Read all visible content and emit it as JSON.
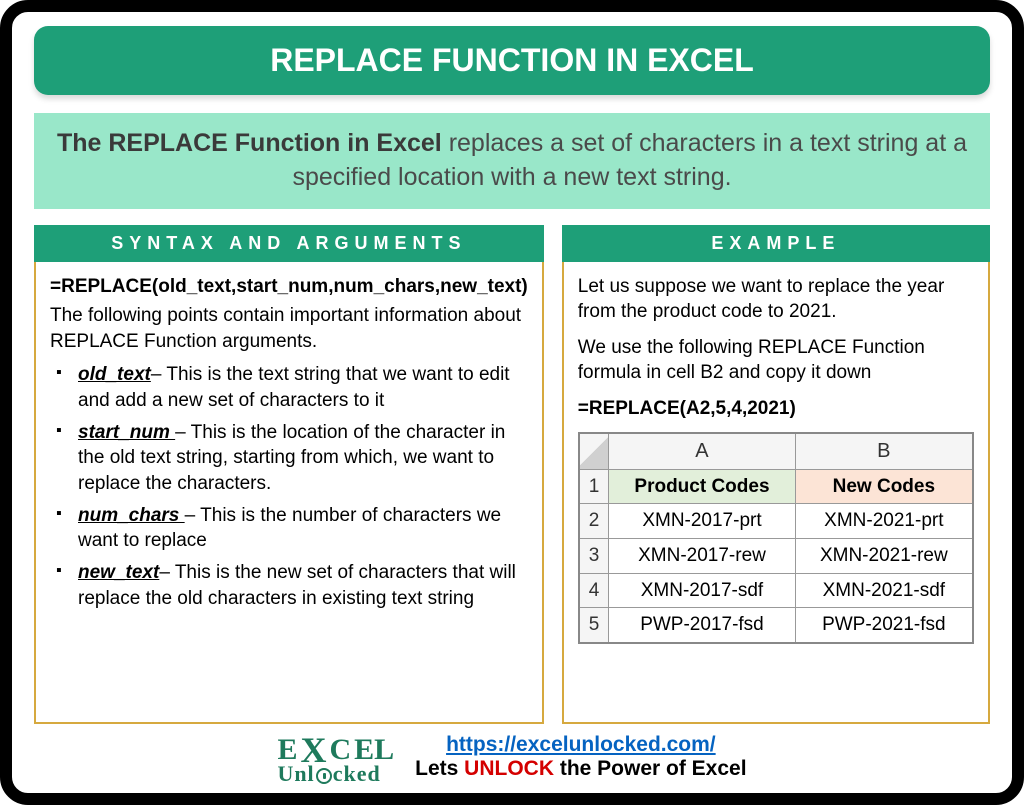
{
  "title": "REPLACE FUNCTION IN EXCEL",
  "description": {
    "bold": "The REPLACE Function in Excel",
    "rest": " replaces a set of characters in a text string at a specified location with a new text string."
  },
  "syntax": {
    "header": "SYNTAX AND ARGUMENTS",
    "formula": "=REPLACE(old_text,start_num,num_chars,new_text)",
    "intro": "The following points contain important information about REPLACE Function arguments.",
    "args": [
      {
        "name": "old_text",
        "desc": "– This is the text string that we want to edit and add a new set of characters to it"
      },
      {
        "name": "start_num ",
        "desc": "– This is the location of the character in the old text string, starting from which, we want to replace the characters."
      },
      {
        "name": "num_chars ",
        "desc": "– This is the number of characters we want to replace"
      },
      {
        "name": "new_text",
        "desc": "– This is the new set of characters that will replace the old characters in existing text string"
      }
    ]
  },
  "example": {
    "header": "EXAMPLE",
    "p1": "Let us suppose we want to replace the year from the product code to 2021.",
    "p2": "We use the following REPLACE Function formula in cell B2 and copy it down",
    "formula": "=REPLACE(A2,5,4,2021)",
    "table": {
      "col_labels": [
        "A",
        "B"
      ],
      "headers": [
        "Product Codes",
        "New Codes"
      ],
      "rows": [
        {
          "n": "2",
          "a": "XMN-2017-prt",
          "b": "XMN-2021-prt"
        },
        {
          "n": "3",
          "a": "XMN-2017-rew",
          "b": "XMN-2021-rew"
        },
        {
          "n": "4",
          "a": "XMN-2017-sdf",
          "b": "XMN-2021-sdf"
        },
        {
          "n": "5",
          "a": "PWP-2017-fsd",
          "b": "PWP-2021-fsd"
        }
      ]
    }
  },
  "footer": {
    "logo_top": "EXCEL",
    "logo_bottom": "Unlocked",
    "url": "https://excelunlocked.com/",
    "tagline_pre": "Lets ",
    "tagline_unlock": "UNLOCK",
    "tagline_post": " the Power of Excel"
  }
}
